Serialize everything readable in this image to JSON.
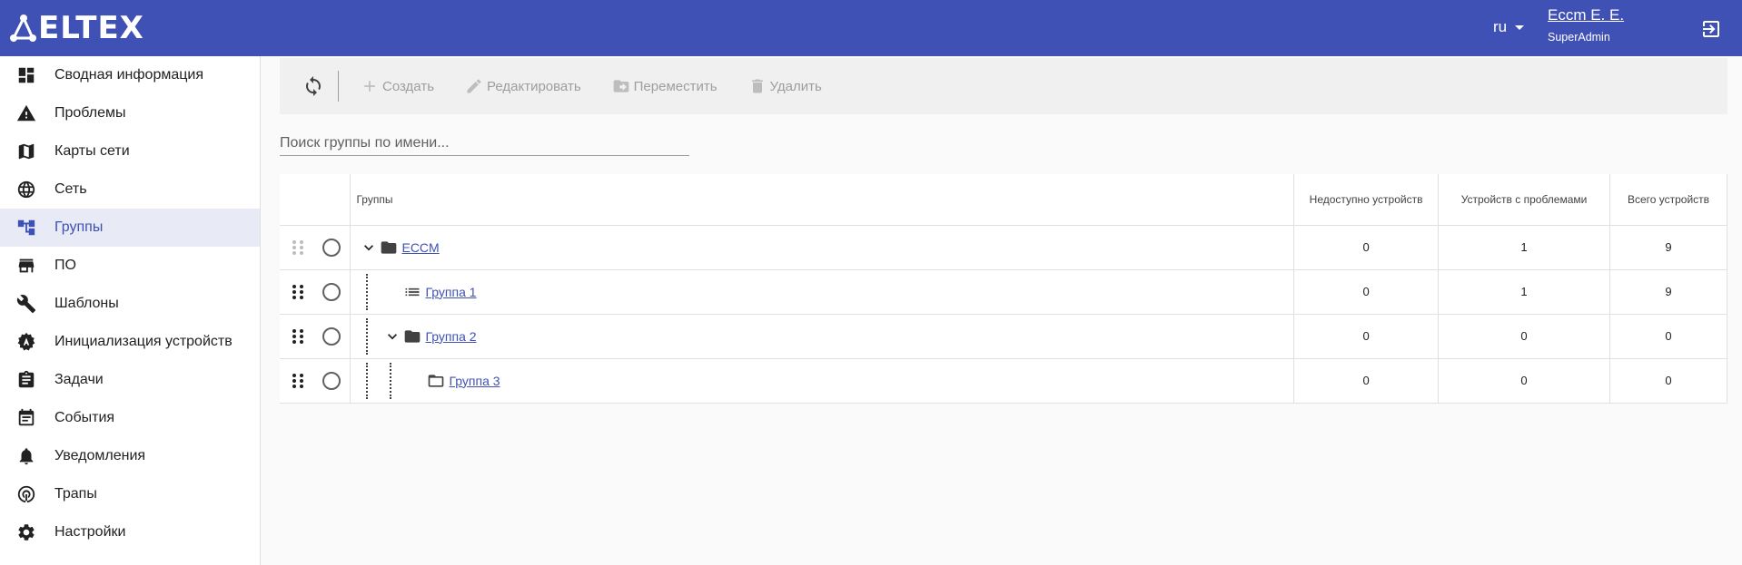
{
  "header": {
    "logo_text": "ELTEX",
    "lang": "ru",
    "user_name": "Eccm E. E.",
    "user_role": "SuperAdmin",
    "bg_color": "#3f51b5"
  },
  "sidebar": {
    "active_index": 4,
    "items": [
      {
        "label": "Сводная информация",
        "icon": "dashboard-icon"
      },
      {
        "label": "Проблемы",
        "icon": "warning-icon"
      },
      {
        "label": "Карты сети",
        "icon": "map-icon"
      },
      {
        "label": "Сеть",
        "icon": "globe-icon"
      },
      {
        "label": "Группы",
        "icon": "account-tree-icon"
      },
      {
        "label": "ПО",
        "icon": "store-icon"
      },
      {
        "label": "Шаблоны",
        "icon": "wrench-icon"
      },
      {
        "label": "Инициализация устройств",
        "icon": "auto-gear-icon"
      },
      {
        "label": "Задачи",
        "icon": "clipboard-icon"
      },
      {
        "label": "События",
        "icon": "calendar-icon"
      },
      {
        "label": "Уведомления",
        "icon": "bell-icon"
      },
      {
        "label": "Трапы",
        "icon": "trap-icon"
      },
      {
        "label": "Настройки",
        "icon": "gear-icon"
      }
    ]
  },
  "toolbar": {
    "create_label": "Создать",
    "edit_label": "Редактировать",
    "move_label": "Переместить",
    "delete_label": "Удалить"
  },
  "search": {
    "placeholder": "Поиск группы по имени..."
  },
  "table": {
    "headers": {
      "groups": "Группы",
      "unavailable": "Недоступно устройств",
      "with_problems": "Устройств с проблемами",
      "total": "Всего устройств"
    },
    "rows": [
      {
        "name": "ECCM",
        "unavailable": "0",
        "with_problems": "1",
        "total": "9",
        "depth": 0,
        "expanded": true,
        "icon": "folder-icon"
      },
      {
        "name": "Группа 1",
        "unavailable": "0",
        "with_problems": "1",
        "total": "9",
        "depth": 1,
        "expanded": false,
        "icon": "list-icon"
      },
      {
        "name": "Группа 2",
        "unavailable": "0",
        "with_problems": "0",
        "total": "0",
        "depth": 1,
        "expanded": true,
        "icon": "folder-icon"
      },
      {
        "name": "Группа 3",
        "unavailable": "0",
        "with_problems": "0",
        "total": "0",
        "depth": 2,
        "expanded": false,
        "icon": "folder-open-icon"
      }
    ]
  }
}
